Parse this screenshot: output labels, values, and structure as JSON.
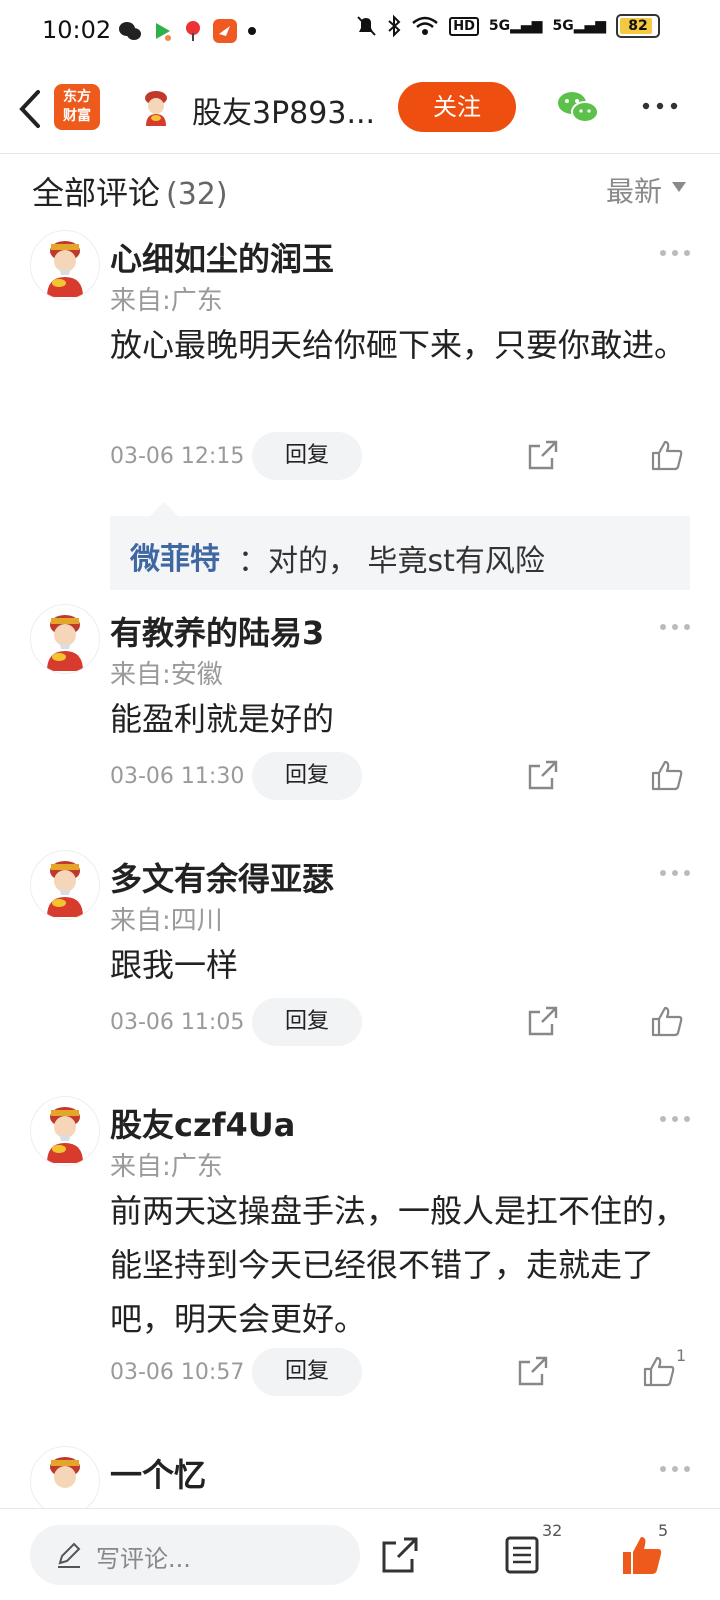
{
  "status_bar": {
    "time": "10:02",
    "battery": "82",
    "signal_label_1": "5G",
    "signal_label_2": "5G",
    "hd_label": "HD"
  },
  "nav": {
    "app_logo_line1": "东方",
    "app_logo_line2": "财富",
    "title": "股友3P893...",
    "follow_label": "关注"
  },
  "comments_header": {
    "title": "全部评论",
    "count": "(32)",
    "sort_label": "最新"
  },
  "comments": [
    {
      "name": "心细如尘的润玉",
      "location": "来自:广东",
      "body": "放心最晚明天给你砸下来，只要你敢进。",
      "time": "03-06 12:15",
      "reply_label": "回复",
      "like_count": ""
    },
    {
      "name": "有教养的陆易3",
      "location": "来自:安徽",
      "body": "能盈利就是好的",
      "time": "03-06 11:30",
      "reply_label": "回复",
      "like_count": ""
    },
    {
      "name": "多文有余得亚瑟",
      "location": "来自:四川",
      "body": "跟我一样",
      "time": "03-06 11:05",
      "reply_label": "回复",
      "like_count": ""
    },
    {
      "name": "股友czf4Ua",
      "location": "来自:广东",
      "body": "前两天这操盘手法，一般人是扛不住的，能坚持到今天已经很不错了，走就走了吧，明天会更好。",
      "time": "03-06 10:57",
      "reply_label": "回复",
      "like_count": "1"
    },
    {
      "name": "一个忆",
      "location": "",
      "body": "",
      "time": "",
      "reply_label": "",
      "like_count": ""
    }
  ],
  "reply_preview": {
    "user": "微菲特",
    "text": "：对的， 毕竟st有风险"
  },
  "bottom_bar": {
    "write_placeholder": "写评论...",
    "comments_count": "32",
    "like_count": "5"
  },
  "colors": {
    "accent": "#ee4f10",
    "link_blue": "#3f68a3",
    "wechat_green": "#5bc14a"
  }
}
